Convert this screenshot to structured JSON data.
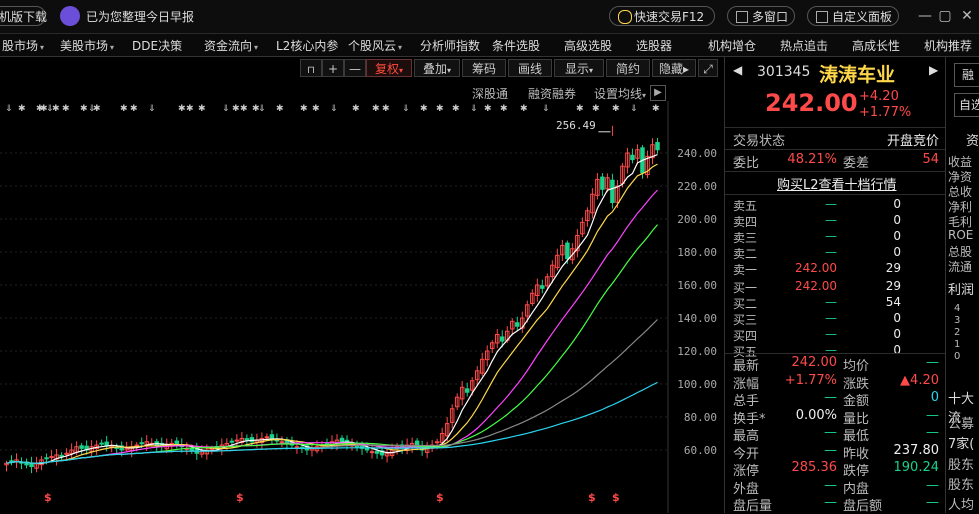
{
  "topbar": {
    "left_tab": "机版下载",
    "notice": "已为您整理今日早报",
    "quick_trade": "快速交易F12",
    "multi_window": "多窗口",
    "custom_panel": "自定义面板",
    "min_icon": "—",
    "restore_icon": "▢",
    "close_icon": "✕"
  },
  "menubar": {
    "items": [
      "股市场",
      "美股市场",
      "DDE决策",
      "资金流向",
      "L2核心内参",
      "个股风云",
      "分析师指数",
      "条件选股",
      "高级选股",
      "选股器",
      "机构增仓",
      "热点追击",
      "高成长性",
      "机构推荐"
    ],
    "caret": "▾"
  },
  "toolbar": {
    "lock_icon": "🔒",
    "plus": "+",
    "minus": "—",
    "fuquan": "复权",
    "diejia": "叠加",
    "choumа": "筹码",
    "huaxian": "画线",
    "xianshi": "显示",
    "jianyue": "简约",
    "yincang": "隐藏",
    "arrow": "▸",
    "expand_icon": "⤢"
  },
  "subbar": {
    "shengutong": "深股通",
    "rongzi": "融资融券",
    "average": "设置均线"
  },
  "chart": {
    "y_ticks": [
      "240.00",
      "220.00",
      "200.00",
      "180.00",
      "160.00",
      "140.00",
      "120.00",
      "100.00",
      "80.00",
      "60.00"
    ],
    "peak_label": "256.49",
    "star": "✱",
    "arrow_down": "⇓",
    "dollar": "$"
  },
  "chart_data": {
    "type": "candlestick",
    "ylim": [
      40,
      262
    ],
    "y_ticks": [
      60,
      80,
      100,
      120,
      140,
      160,
      180,
      200,
      220,
      240
    ],
    "annotation_peak": 256.49,
    "close_series": [
      52,
      53,
      54,
      52,
      51,
      50,
      52,
      54,
      55,
      56,
      57,
      56,
      58,
      60,
      62,
      61,
      60,
      62,
      63,
      64,
      63,
      62,
      61,
      60,
      61,
      62,
      63,
      64,
      65,
      64,
      63,
      62,
      63,
      64,
      63,
      62,
      61,
      60,
      58,
      59,
      60,
      61,
      62,
      63,
      64,
      65,
      66,
      67,
      66,
      65,
      66,
      67,
      68,
      67,
      66,
      65,
      64,
      63,
      62,
      61,
      60,
      61,
      62,
      63,
      64,
      65,
      66,
      65,
      64,
      63,
      62,
      61,
      60,
      59,
      58,
      57,
      58,
      60,
      62,
      61,
      63,
      64,
      62,
      60,
      61,
      63,
      65,
      70,
      76,
      85,
      92,
      98,
      95,
      102,
      108,
      115,
      120,
      125,
      130,
      126,
      132,
      138,
      135,
      140,
      148,
      155,
      160,
      158,
      165,
      172,
      178,
      184,
      176,
      182,
      190,
      198,
      205,
      215,
      224,
      218,
      225,
      210,
      220,
      232,
      240,
      236,
      242,
      228,
      238,
      245,
      242
    ]
  },
  "quote": {
    "code": "301345",
    "name": "涛涛车业",
    "price": "242.00",
    "change": "+4.20",
    "pct": "+1.77%",
    "left_arrow": "◀",
    "right_arrow": "▶"
  },
  "status": {
    "trade_state_label": "交易状态",
    "trade_state": "开盘竞价",
    "weibi_label": "委比",
    "weibi": "48.21%",
    "weicha_label": "委差",
    "weicha": "54",
    "l2_link": "购买L2查看十档行情"
  },
  "orderbook": {
    "sells": [
      {
        "label": "卖五",
        "price": "—",
        "vol": "0"
      },
      {
        "label": "卖四",
        "price": "—",
        "vol": "0"
      },
      {
        "label": "卖三",
        "price": "—",
        "vol": "0"
      },
      {
        "label": "卖二",
        "price": "—",
        "vol": "0"
      },
      {
        "label": "卖一",
        "price": "242.00",
        "vol": "29"
      }
    ],
    "buys": [
      {
        "label": "买一",
        "price": "242.00",
        "vol": "29"
      },
      {
        "label": "买二",
        "price": "—",
        "vol": "54"
      },
      {
        "label": "买三",
        "price": "—",
        "vol": "0"
      },
      {
        "label": "买四",
        "price": "—",
        "vol": "0"
      },
      {
        "label": "买五",
        "price": "—",
        "vol": "0"
      }
    ]
  },
  "stats": [
    {
      "l1": "最新",
      "v1": "242.00",
      "c1": "red",
      "l2": "均价",
      "v2": "—",
      "c2": "green"
    },
    {
      "l1": "涨幅",
      "v1": "+1.77%",
      "c1": "red",
      "l2": "涨跌",
      "v2": "▲4.20",
      "c2": "red"
    },
    {
      "l1": "总手",
      "v1": "—",
      "c1": "green",
      "l2": "金额",
      "v2": "0",
      "c2": "cyan"
    },
    {
      "l1": "换手*",
      "v1": "0.00%",
      "c1": "white",
      "l2": "量比",
      "v2": "—",
      "c2": "green"
    },
    {
      "l1": "最高",
      "v1": "—",
      "c1": "green",
      "l2": "最低",
      "v2": "—",
      "c2": "green"
    },
    {
      "l1": "今开",
      "v1": "—",
      "c1": "green",
      "l2": "昨收",
      "v2": "237.80",
      "c2": "white"
    },
    {
      "l1": "涨停",
      "v1": "285.36",
      "c1": "red",
      "l2": "跌停",
      "v2": "190.24",
      "c2": "green"
    },
    {
      "l1": "外盘",
      "v1": "—",
      "c1": "green",
      "l2": "内盘",
      "v2": "—",
      "c2": "green"
    },
    {
      "l1": "盘后量",
      "v1": "—",
      "c1": "green",
      "l2": "盘后额",
      "v2": "—",
      "c2": "green"
    }
  ],
  "farright": {
    "btn1": "融",
    "btn2": "自选",
    "tab": "资",
    "rows": [
      "收益",
      "净资",
      "总收",
      "净利",
      "毛利",
      "ROE",
      "总股",
      "流通"
    ],
    "profit": "利润",
    "nums": [
      "4",
      "3",
      "2",
      "1",
      "0"
    ],
    "top10": "十大流",
    "gongying": "公募",
    "jia": "7家(",
    "holder1": "股东",
    "holder2": "股东",
    "renjun": "人均"
  },
  "colors": {
    "up": "#ff4a4a",
    "down": "#19d18b",
    "ma5": "#ffffff",
    "ma10": "#ffd84a",
    "ma20": "#ff44ff",
    "ma30": "#44ff44",
    "ma60": "#888888",
    "ma120": "#2ad4f0"
  }
}
